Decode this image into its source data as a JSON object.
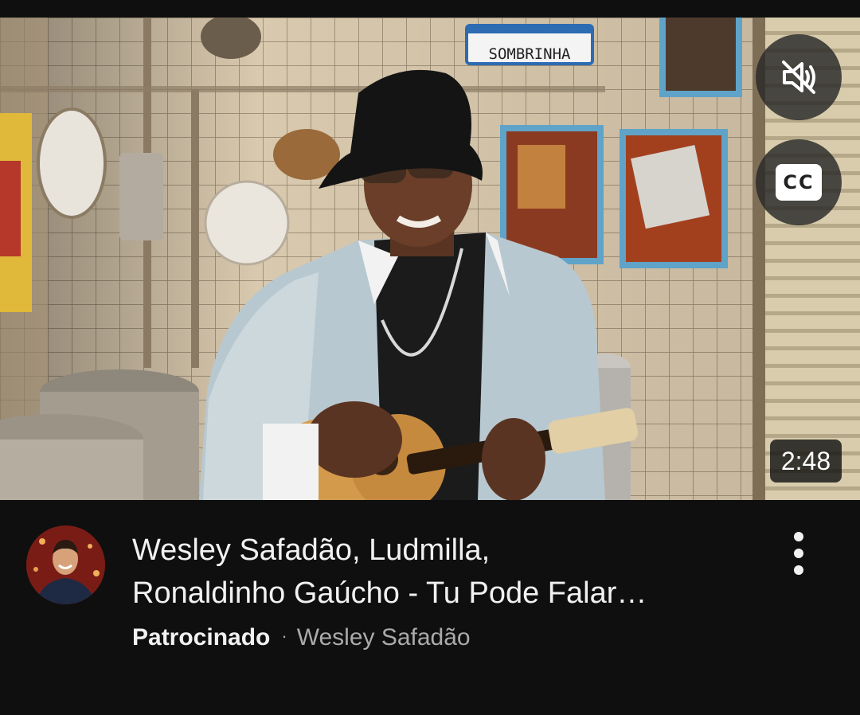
{
  "video": {
    "duration": "2:48",
    "cc_label": "CC",
    "mute_icon": "speaker-muted-icon",
    "sign_text": "SOMBRINHA"
  },
  "ad": {
    "title_line1": "Wesley Safadão, Ludmilla,",
    "title_line2": "Ronaldinho Gaúcho - Tu Pode Falar…",
    "sponsored_label": "Patrocinado",
    "separator": "·",
    "channel_name": "Wesley Safadão",
    "menu_icon": "more-vert-icon"
  },
  "colors": {
    "background": "#0f0f0f",
    "title_text": "#f1f1f1",
    "secondary_text": "#aaaaaa"
  }
}
